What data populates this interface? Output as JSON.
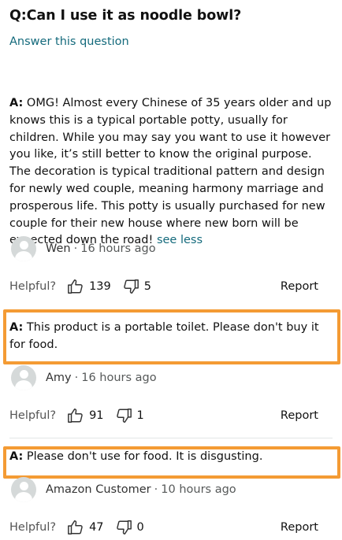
{
  "question": {
    "text": "Q:Can I use it as noodle bowl?"
  },
  "answer_link": "Answer this question",
  "answers": [
    {
      "label": "A:",
      "text": " OMG!  Almost every Chinese of 35 years older and up knows this is a typical portable potty, usually for children. While you may say you want to use it however you like, it’s still better to know the original purpose. The decoration is typical traditional pattern and design for newly wed couple, meaning harmony marriage and prosperous life. This potty is usually purchased for new couple for their new house where new born will be expected down the road! ",
      "see_less": "see less",
      "author": "Wen",
      "separator": "·",
      "time": "16 hours ago",
      "helpful_label": "Helpful?",
      "up_count": "139",
      "down_count": "5",
      "report": "Report"
    },
    {
      "label": "A:",
      "text": " This product is a portable toilet. Please don't buy it for food.",
      "author": "Amy",
      "separator": "·",
      "time": "16 hours ago",
      "helpful_label": "Helpful?",
      "up_count": "91",
      "down_count": "1",
      "report": "Report"
    },
    {
      "label": "A:",
      "text": " Please don't use for food. It is disgusting.",
      "author": "Amazon Customer",
      "separator": "·",
      "time": "10 hours ago",
      "helpful_label": "Helpful?",
      "up_count": "47",
      "down_count": "0",
      "report": "Report"
    }
  ],
  "highlight_color": "#f49b34",
  "link_color": "#146a7c",
  "icons": [
    "user-avatar-icon",
    "thumbs-up-icon",
    "thumbs-down-icon"
  ]
}
